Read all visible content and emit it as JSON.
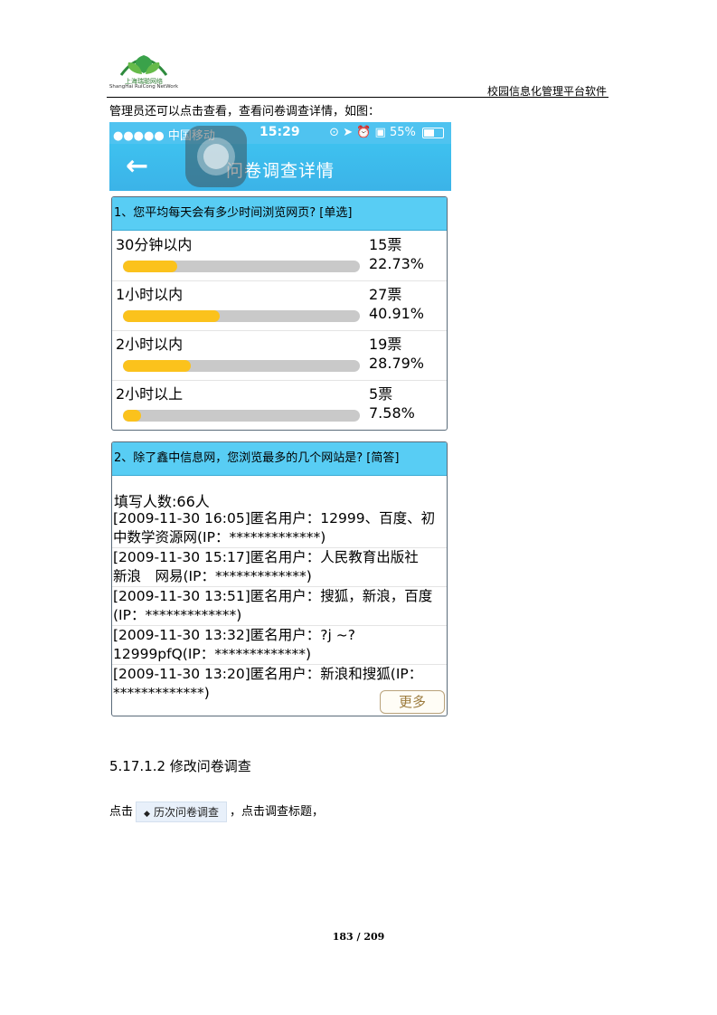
{
  "header": {
    "logo_cn": "上海瑞聪网络",
    "logo_en": "ShangHai RuiCong NetWork",
    "doc_title": "校园信息化管理平台软件"
  },
  "intro_text": "管理员还可以点击查看，查看问卷调查详情，如图：",
  "phone": {
    "status": {
      "carrier": "●●●●● 中国移动",
      "time": "15:29",
      "right": "⊙ ➤ ⏰ ▣ 55%",
      "battery_level": 0.55
    },
    "nav_title": "问卷调查详情",
    "question1": {
      "title": "1、您平均每天会有多少时间浏览网页? [单选]",
      "options": [
        {
          "label": "30分钟以内",
          "votes": "15票",
          "percent": "22.73%",
          "value": 22.73
        },
        {
          "label": "1小时以内",
          "votes": "27票",
          "percent": "40.91%",
          "value": 40.91
        },
        {
          "label": "2小时以内",
          "votes": "19票",
          "percent": "28.79%",
          "value": 28.79
        },
        {
          "label": "2小时以上",
          "votes": "5票",
          "percent": "7.58%",
          "value": 7.58
        }
      ]
    },
    "question2": {
      "title": "2、除了鑫中信息网，您浏览最多的几个网站是? [简答]",
      "fill_count": "填写人数:66人",
      "answers": [
        {
          "line1": "[2009-11-30 16:05]匿名用户：12999、百度、初",
          "line2": "中数学资源网(IP：*************)"
        },
        {
          "line1": "[2009-11-30 15:17]匿名用户：人民教育出版社",
          "line2": "新浪　网易(IP：*************)"
        },
        {
          "line1": "[2009-11-30 13:51]匿名用户：搜狐，新浪，百度",
          "line2": "(IP：*************)"
        },
        {
          "line1": "[2009-11-30 13:32]匿名用户：?j ~?",
          "line2": "12999pfQ(IP：*************)"
        },
        {
          "line1": "[2009-11-30 13:20]匿名用户：新浪和搜狐(IP：",
          "line2": "*************)"
        }
      ],
      "more_label": "更多"
    }
  },
  "section_title": "5.17.1.2 修改问卷调查",
  "para": {
    "prefix": "点击",
    "button_label": "历次问卷调查",
    "suffix": "，点击调查标题，"
  },
  "page_number": "183 / 209"
}
